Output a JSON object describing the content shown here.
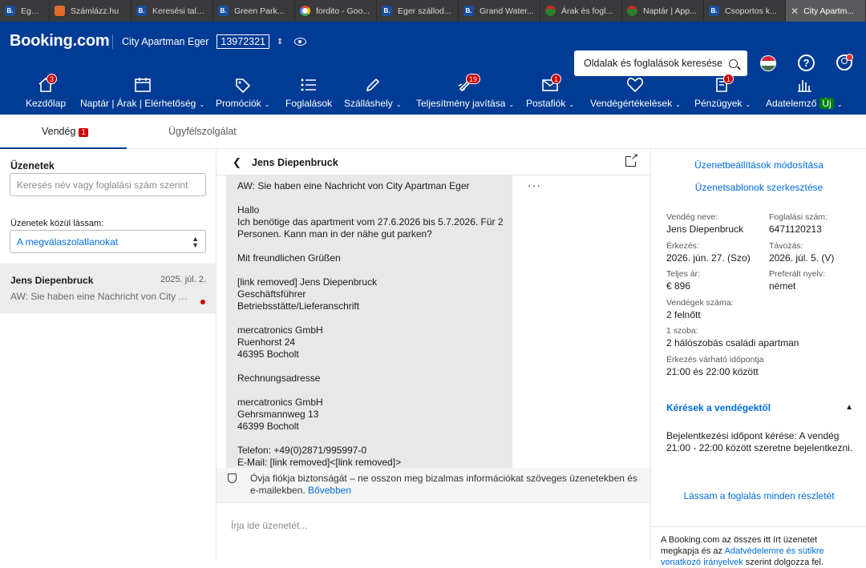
{
  "browser_tabs": [
    {
      "title": "Eger sz",
      "icon": "b"
    },
    {
      "title": "Számlázz.hu",
      "icon": "o"
    },
    {
      "title": "Keresési talá...",
      "icon": "b"
    },
    {
      "title": "Green Park...",
      "icon": "b"
    },
    {
      "title": "fordito - Goo...",
      "icon": "g"
    },
    {
      "title": "Eger szállod...",
      "icon": "b"
    },
    {
      "title": "Grand Water...",
      "icon": "b"
    },
    {
      "title": "Árak és fogl...",
      "icon": "h"
    },
    {
      "title": "Naptár | App...",
      "icon": "h"
    },
    {
      "title": "Csoportos k...",
      "icon": "b"
    },
    {
      "title": "City Apartm...",
      "icon": "close"
    }
  ],
  "header": {
    "logo": "Booking.com",
    "property_name": "City Apartman Eger",
    "property_id": "13972321",
    "search_placeholder": "Oldalak és foglalások keresése",
    "help": "?"
  },
  "nav": [
    {
      "label": "Kezdőlap",
      "badge": "3",
      "chevron": ""
    },
    {
      "label": "Naptár | Árak | Elérhetőség",
      "badge": "",
      "chevron": "⌄"
    },
    {
      "label": "Promóciók",
      "badge": "",
      "chevron": "⌄"
    },
    {
      "label": "Foglalások",
      "badge": "",
      "chevron": ""
    },
    {
      "label": "Szálláshely",
      "badge": "",
      "chevron": "⌄"
    },
    {
      "label": "Teljesítmény javítása",
      "badge": "19",
      "chevron": "⌄"
    },
    {
      "label": "Postafiók",
      "badge": "1",
      "chevron": "⌄"
    },
    {
      "label": "Vendégértékelések",
      "badge": "",
      "chevron": "⌄"
    },
    {
      "label": "Pénzügyek",
      "badge": "1",
      "chevron": "⌄"
    },
    {
      "label": "Adatelemző",
      "badge": "",
      "chevron": "⌄",
      "tag": "Új"
    }
  ],
  "subtabs": {
    "guest": "Vendég",
    "guest_count": "1",
    "support": "Ügyfélszolgálat"
  },
  "left": {
    "title": "Üzenetek",
    "search_placeholder": "Keresés név vagy foglalási szám szerint",
    "filter_label": "Üzenetek közül lássam:",
    "filter_value": "A megválaszolatlanokat",
    "conversation": {
      "name": "Jens Diepenbruck",
      "date": "2025. júl. 2.",
      "preview": "AW: Sie haben eine Nachricht von City Apartman Eger"
    }
  },
  "thread": {
    "name": "Jens Diepenbruck",
    "more": "···",
    "lines": [
      "AW: Sie haben eine Nachricht von City Apartman Eger",
      "",
      "Hallo",
      "Ich benötige das apartment vom 27.6.2026 bis 5.7.2026. Für 2",
      "Personen. Kann man in der nähe gut parken?",
      "",
      "Mit freundlichen Grüßen",
      "",
      "[link removed] Jens Diepenbruck",
      "Geschäftsführer",
      "Betriebsstätte/Lieferanschrift",
      "",
      "mercatronics GmbH",
      "Ruenhorst 24",
      "46395 Bocholt",
      "",
      "Rechnungsadresse",
      "",
      "mercatronics GmbH",
      "Gehrsmannweg 13",
      "46399 Bocholt",
      "",
      "Telefon: +49(0)2871/995997-0",
      "E-Mail: [link removed]<[link removed]>"
    ],
    "notice": "Óvja fiókja biztonságát – ne osszon meg bizalmas információkat szöveges üzenetekben és e-mailekben.",
    "notice_link": "Bővebben",
    "reply_placeholder": "Írja ide üzenetét..."
  },
  "right": {
    "link_settings": "Üzenetbeállítások módosítása",
    "link_templates": "Üzenetsablonok szerkesztése",
    "guest_name_label": "Vendég neve:",
    "guest_name": "Jens Diepenbruck",
    "booking_no_label": "Foglalási szám:",
    "booking_no": "6471120213",
    "arrival_label": "Érkezés:",
    "arrival": "2026. jún. 27. (Szo)",
    "departure_label": "Távozás:",
    "departure": "2026. júl. 5. (V)",
    "total_label": "Teljes ár:",
    "total": "€ 896",
    "lang_label": "Preferált nyelv:",
    "lang": "német",
    "guests_label": "Vendégek száma:",
    "guests": "2 felnőtt",
    "rooms_label": "1 szoba:",
    "rooms": "2 hálószobás családi apartman",
    "eta_label": "Érkezés várható időpontja",
    "eta": "21:00 és 22:00 között",
    "requests_title": "Kérések a vendégektől",
    "requests_text": "Bejelentkezési időpont kérése: A vendég 21:00 - 22:00 között szeretne bejelentkezni.",
    "all_details": "Lássam a foglalás minden részletét",
    "footer_text": "A Booking.com az összes itt írt üzenetet megkapja és az",
    "footer_link": "Adatvédelemre és sütikre vonatkozó irányelvek",
    "footer_tail": "szerint dolgozza fel."
  },
  "colors": {
    "brand": "#003b95",
    "link": "#006ce4",
    "badge": "#cc0000",
    "new": "#008009"
  }
}
